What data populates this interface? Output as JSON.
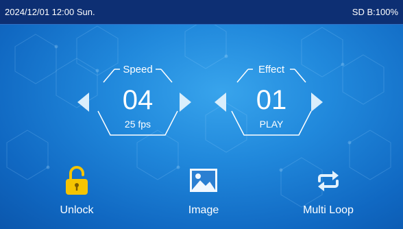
{
  "status_bar": {
    "datetime": "2024/12/01 12:00 Sun.",
    "storage": "SD B:100%"
  },
  "speed": {
    "title": "Speed",
    "value": "04",
    "sub": "25 fps"
  },
  "effect": {
    "title": "Effect",
    "value": "01",
    "sub": "PLAY"
  },
  "buttons": {
    "unlock": "Unlock",
    "image": "Image",
    "multi_loop": "Multi Loop"
  },
  "colors": {
    "status_bar_bg": "#0d2f73",
    "accent": "#f5c400",
    "icon_light": "#d9eefc",
    "background": "#2189dc"
  },
  "icons": {
    "prev": "triangle-left-icon",
    "next": "triangle-right-icon",
    "unlock": "padlock-open-icon",
    "image": "picture-icon",
    "multi_loop": "loop-arrows-icon"
  }
}
